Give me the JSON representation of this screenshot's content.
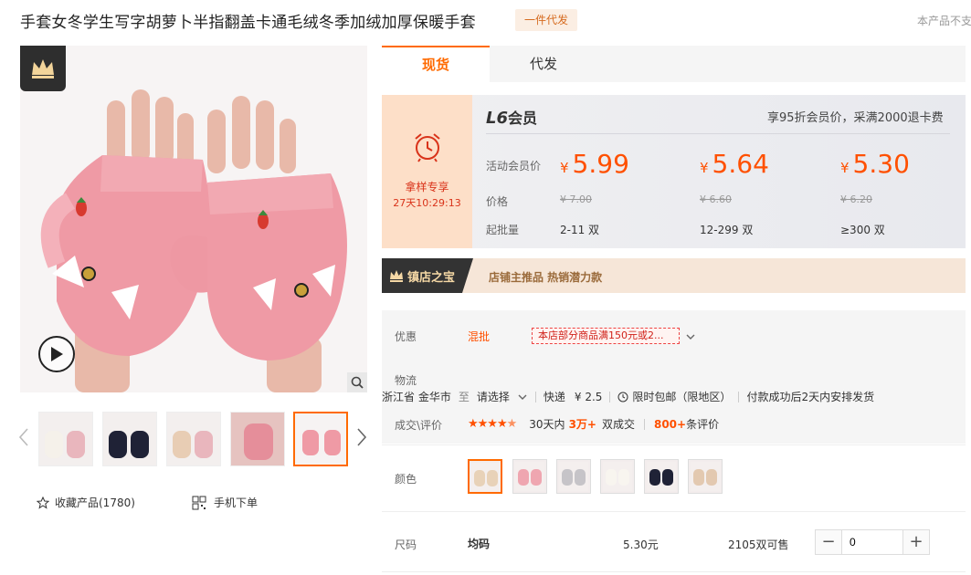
{
  "product": {
    "title": "手套女冬学生写字胡萝卜半指翻盖卡通毛绒冬季加绒加厚保暖手套",
    "dropship_badge": "一件代发",
    "not_supported": "本产品不支"
  },
  "tabs": [
    {
      "label": "现货",
      "active": true
    },
    {
      "label": "代发",
      "active": false
    }
  ],
  "promo": {
    "label": "拿样专享",
    "timer": "27天10:29:13"
  },
  "member": {
    "level_code": "L6",
    "level_suffix": "会员",
    "benefit": "享95折会员价，采满2000退卡费"
  },
  "pricing": {
    "row_labels": {
      "member_price": "活动会员价",
      "price": "价格",
      "moq": "起批量"
    },
    "currency": "¥",
    "tiers": [
      {
        "member_price": "5.99",
        "original": "7.00",
        "moq": "2-11 双"
      },
      {
        "member_price": "5.64",
        "original": "6.60",
        "moq": "12-299 双"
      },
      {
        "member_price": "5.30",
        "original": "6.20",
        "moq": "≥300 双"
      }
    ]
  },
  "treasure": {
    "tag": "镇店之宝",
    "desc": "店铺主推品   热销潜力款"
  },
  "details": {
    "offer_label": "优惠",
    "offer_type": "混批",
    "offer_coupon": "本店部分商品满150元或2...",
    "logistics_label": "物流",
    "origin": "浙江省 金华市",
    "to": "至",
    "destination": "请选择",
    "express": "快递",
    "express_fee": "¥ 2.5",
    "free_shipping": "限时包邮（限地区）",
    "dispatch": "付款成功后2天内安排发货",
    "rating_label": "成交\\评价",
    "sales_prefix": "30天内",
    "sales_count": "3万+",
    "sales_suffix": "双成交",
    "reviews_count": "800+",
    "reviews_suffix": "条评价",
    "rating": 4.5
  },
  "color": {
    "label": "颜色",
    "swatches": [
      "pink",
      "pink-light",
      "gray",
      "white",
      "black",
      "beige"
    ]
  },
  "size": {
    "label": "尺码",
    "name": "均码",
    "price": "5.30元",
    "stock": "2105双可售",
    "quantity": "0"
  },
  "actions": {
    "favorite": "收藏产品(1780)",
    "mobile_order": "手机下单"
  },
  "colors": {
    "accent": "#ff5000",
    "tab_accent": "#ff6a00",
    "promo_bg": "#fddfc8"
  }
}
